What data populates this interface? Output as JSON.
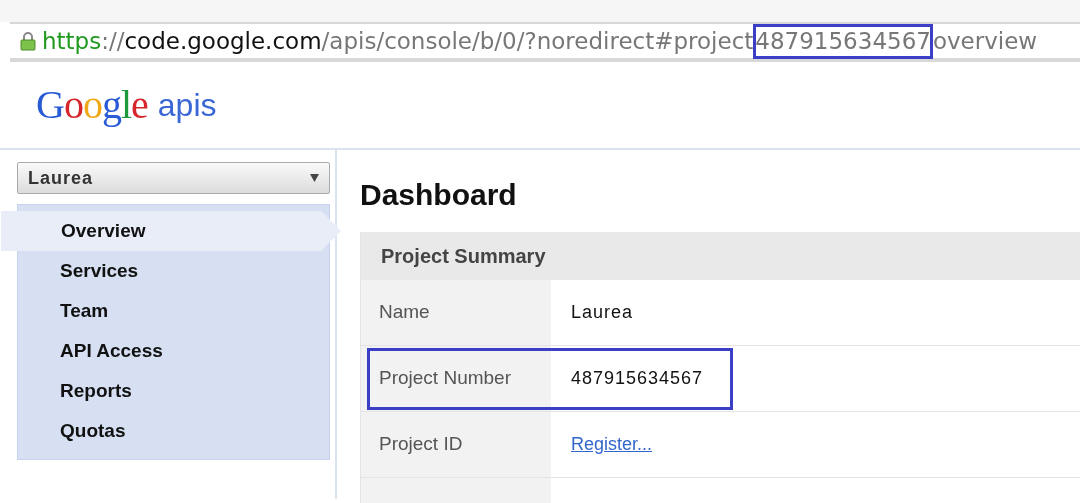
{
  "address_bar": {
    "secure": true,
    "segments": [
      {
        "text": "https",
        "kind": "scheme",
        "highlighted": false
      },
      {
        "text": "://",
        "kind": "separator",
        "highlighted": false
      },
      {
        "text": "code.google.com",
        "kind": "host",
        "highlighted": false
      },
      {
        "text": "/apis/console/b/0/?noredirect#project",
        "kind": "path",
        "highlighted": false
      },
      {
        "text": "487915634567",
        "kind": "path",
        "highlighted": true
      },
      {
        "text": "overview",
        "kind": "path",
        "highlighted": false
      }
    ]
  },
  "logo": {
    "brand": "Google",
    "product": "apis"
  },
  "project_selector": {
    "value": "Laurea"
  },
  "sidebar": {
    "items": [
      {
        "label": "Overview",
        "selected": true
      },
      {
        "label": "Services",
        "selected": false
      },
      {
        "label": "Team",
        "selected": false
      },
      {
        "label": "API Access",
        "selected": false
      },
      {
        "label": "Reports",
        "selected": false
      },
      {
        "label": "Quotas",
        "selected": false
      }
    ]
  },
  "main": {
    "title": "Dashboard",
    "summary": {
      "heading": "Project Summary",
      "rows": [
        {
          "label": "Name",
          "value": "Laurea",
          "kind": "text",
          "highlighted": false
        },
        {
          "label": "Project Number",
          "value": "487915634567",
          "kind": "text",
          "highlighted": true
        },
        {
          "label": "Project ID",
          "value": "Register...",
          "kind": "link",
          "highlighted": false
        }
      ]
    }
  }
}
